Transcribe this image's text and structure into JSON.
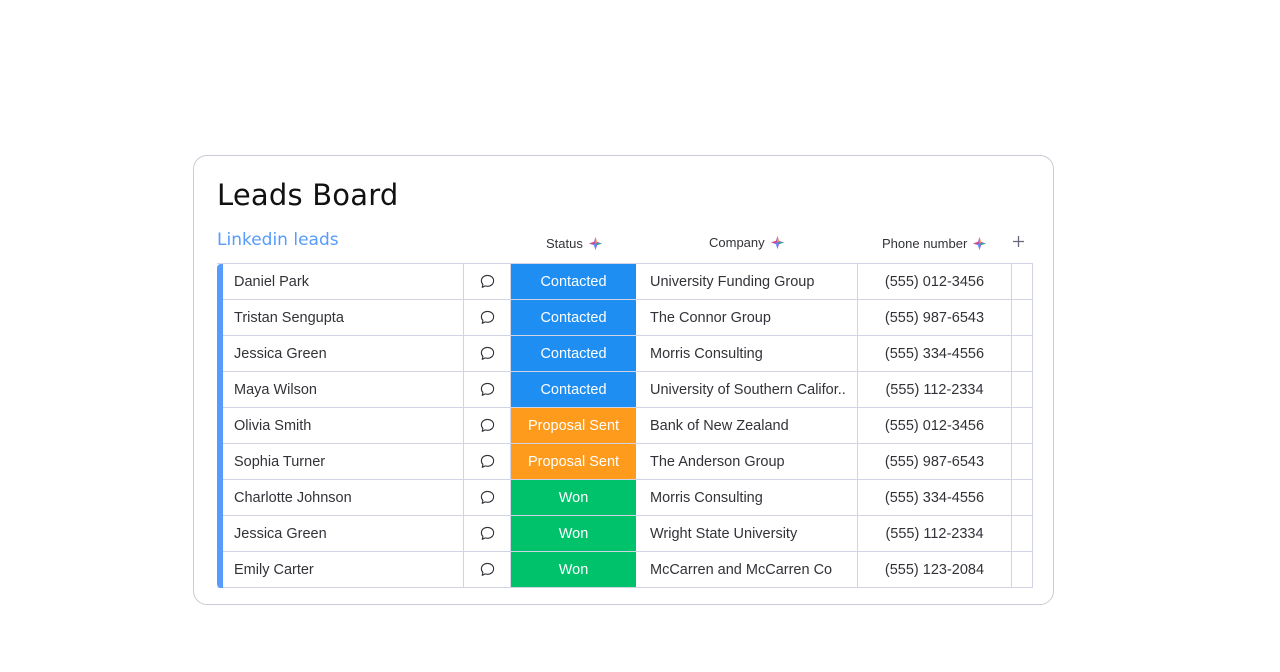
{
  "board": {
    "title": "Leads Board",
    "group_title": "Linkedin leads",
    "group_color": "#579bfc"
  },
  "columns": {
    "status": "Status",
    "company": "Company",
    "phone": "Phone number",
    "add_icon": "plus-icon",
    "header_icon": "ai-sparkle-icon"
  },
  "status_colors": {
    "Contacted": "#1e8ef2",
    "Proposal Sent": "#fe9a1c",
    "Won": "#00c26b"
  },
  "rows": [
    {
      "name": "Daniel Park",
      "status": "Contacted",
      "company": "University Funding Group",
      "phone": "(555) 012-3456"
    },
    {
      "name": "Tristan Sengupta",
      "status": "Contacted",
      "company": "The Connor Group",
      "phone": "(555) 987-6543"
    },
    {
      "name": "Jessica Green",
      "status": "Contacted",
      "company": "Morris Consulting",
      "phone": "(555) 334-4556"
    },
    {
      "name": "Maya Wilson",
      "status": "Contacted",
      "company": "University of Southern Califor..",
      "phone": "(555) 112-2334"
    },
    {
      "name": "Olivia Smith",
      "status": "Proposal Sent",
      "company": "Bank of New Zealand",
      "phone": "(555) 012-3456"
    },
    {
      "name": "Sophia Turner",
      "status": "Proposal Sent",
      "company": "The Anderson Group",
      "phone": "(555) 987-6543"
    },
    {
      "name": "Charlotte Johnson",
      "status": "Won",
      "company": "Morris Consulting",
      "phone": "(555) 334-4556"
    },
    {
      "name": "Jessica Green",
      "status": "Won",
      "company": "Wright State University",
      "phone": "(555) 112-2334"
    },
    {
      "name": "Emily Carter",
      "status": "Won",
      "company": "McCarren and McCarren Co",
      "phone": "(555) 123-2084"
    }
  ]
}
